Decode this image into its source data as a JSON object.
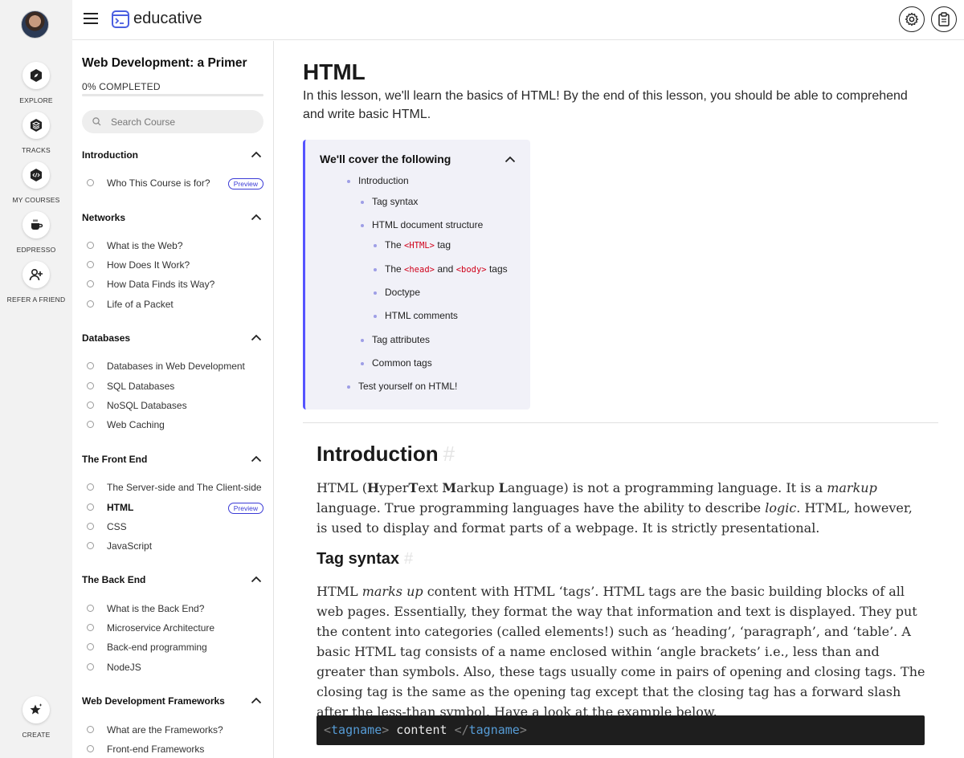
{
  "app": {
    "name": "educative"
  },
  "rail": {
    "items": [
      {
        "label": "EXPLORE",
        "icon": "compass-icon"
      },
      {
        "label": "TRACKS",
        "icon": "layers-icon"
      },
      {
        "label": "MY COURSES",
        "icon": "code-icon"
      },
      {
        "label": "EDPRESSO",
        "icon": "coffee-icon"
      },
      {
        "label": "REFER A FRIEND",
        "icon": "add-user-icon"
      }
    ],
    "create_label": "CREATE"
  },
  "sidebar": {
    "course_title": "Web Development: a Primer",
    "progress_text": "0% COMPLETED",
    "progress_value": 0,
    "search_placeholder": "Search Course",
    "badge_label": "Preview",
    "sections": [
      {
        "title": "Introduction",
        "lessons": [
          "Who This Course is for?"
        ]
      },
      {
        "title": "Networks",
        "lessons": [
          "What is the Web?",
          "How Does It Work?",
          "How Data Finds its Way?",
          "Life of a Packet"
        ]
      },
      {
        "title": "Databases",
        "lessons": [
          "Databases in Web Development",
          "SQL Databases",
          "NoSQL Databases",
          "Web Caching"
        ]
      },
      {
        "title": "The Front End",
        "lessons": [
          "The Server-side and The Client-side",
          "HTML",
          "CSS",
          "JavaScript"
        ]
      },
      {
        "title": "The Back End",
        "lessons": [
          "What is the Back End?",
          "Microservice Architecture",
          "Back-end programming",
          "NodeJS"
        ]
      },
      {
        "title": "Web Development Frameworks",
        "lessons": [
          "What are the Frameworks?",
          "Front-end Frameworks"
        ]
      }
    ]
  },
  "main": {
    "title": "HTML",
    "intro": "In this lesson, we'll learn the basics of HTML! By the end of this lesson, you should be able to comprehend and write basic HTML.",
    "toc": {
      "title": "We'll cover the following",
      "items": {
        "introduction": "Introduction",
        "tag_syntax": "Tag syntax",
        "doc_structure": "HTML document structure",
        "the": "The",
        "html_tag": "<HTML>",
        "tag_word": "tag",
        "head_tag": "<head>",
        "and": "and",
        "body_tag": "<body>",
        "tags_word": "tags",
        "doctype": "Doctype",
        "comments": "HTML comments",
        "attributes": "Tag attributes",
        "common_tags": "Common tags",
        "test": "Test yourself on HTML!"
      }
    },
    "hash": "#",
    "introduction": {
      "heading": "Introduction",
      "p1_a": "HTML (",
      "p1_H": "H",
      "p1_yper": "yper",
      "p1_T": "T",
      "p1_ext": "ext ",
      "p1_M": "M",
      "p1_arkup": "arkup ",
      "p1_L": "L",
      "p1_anguage": "anguage) is not a programming language. It is a ",
      "p1_markup": "markup",
      "p1_b": " language. True programming languages have the ability to describe ",
      "p1_logic": "logic",
      "p1_c": ". HTML, however, is used to display and format parts of a webpage. It is strictly presentational."
    },
    "tag_syntax": {
      "heading": "Tag syntax",
      "p_a": "HTML ",
      "p_marks": "marks up",
      "p_b": " content with HTML ‘tags’. HTML tags are the basic building blocks of all web pages. Essentially, they format the way that information and text is displayed. They put the content into categories (called elements!) such as ‘heading’, ‘paragraph’, and ‘table’. A basic HTML tag consists of a name enclosed within ‘angle brackets’ i.e., less than and greater than symbols. Also, these tags usually come in pairs of opening and closing tags. The closing tag is the same as the opening tag except that the closing tag has a forward slash after the less-than symbol. Have a look at the example below."
    },
    "code": {
      "open_lt": "<",
      "tagname": "tagname",
      "open_gt": ">",
      "content": " content ",
      "close_lt": "</",
      "tagname2": "tagname",
      "close_gt": ">"
    }
  },
  "colors": {
    "accent": "#5553ff",
    "code_bg": "#1e1e1e",
    "code_tag": "#569cd6",
    "inline_code": "#d0021b"
  }
}
